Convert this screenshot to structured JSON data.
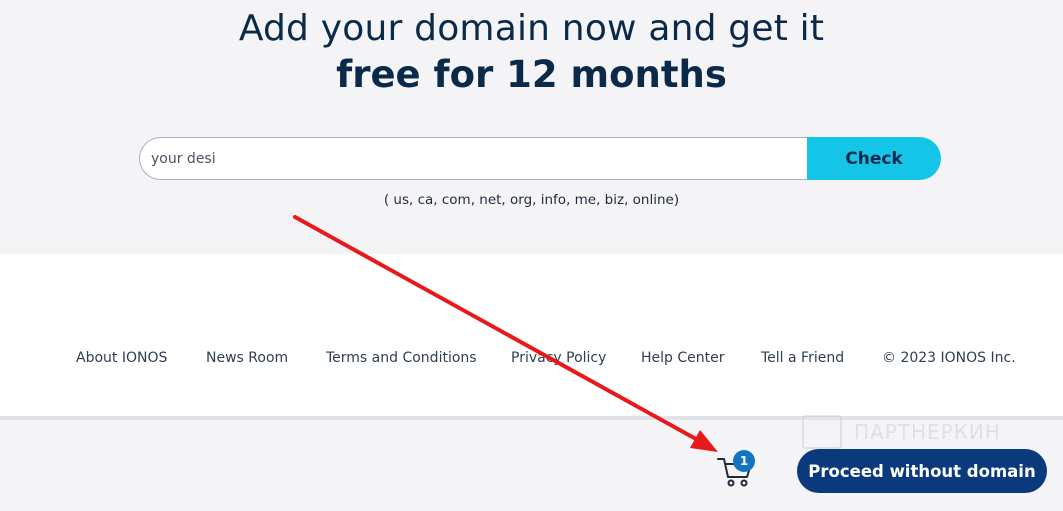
{
  "hero": {
    "headline_line1": "Add your domain now and get it",
    "headline_line2": "free for 12 months"
  },
  "search": {
    "value": "your desi",
    "button_label": "Check",
    "tlds_note": "( us, ca, com, net, org, info, me, biz, online)"
  },
  "footer": {
    "links": [
      "About IONOS",
      "News Room",
      "Terms and Conditions",
      "Privacy Policy",
      "Help Center",
      "Tell a Friend",
      "© 2023 IONOS Inc."
    ]
  },
  "cart": {
    "icon": "shopping-cart-icon",
    "count": "1"
  },
  "proceed_button_label": "Proceed without domain",
  "watermark_text": "ПАРТНЕРКИН",
  "colors": {
    "check_button": "#14c5e8",
    "primary_button": "#0b3a7c",
    "badge": "#1474c4",
    "annotation_arrow": "#e8191b",
    "headline": "#0b2a4a"
  }
}
